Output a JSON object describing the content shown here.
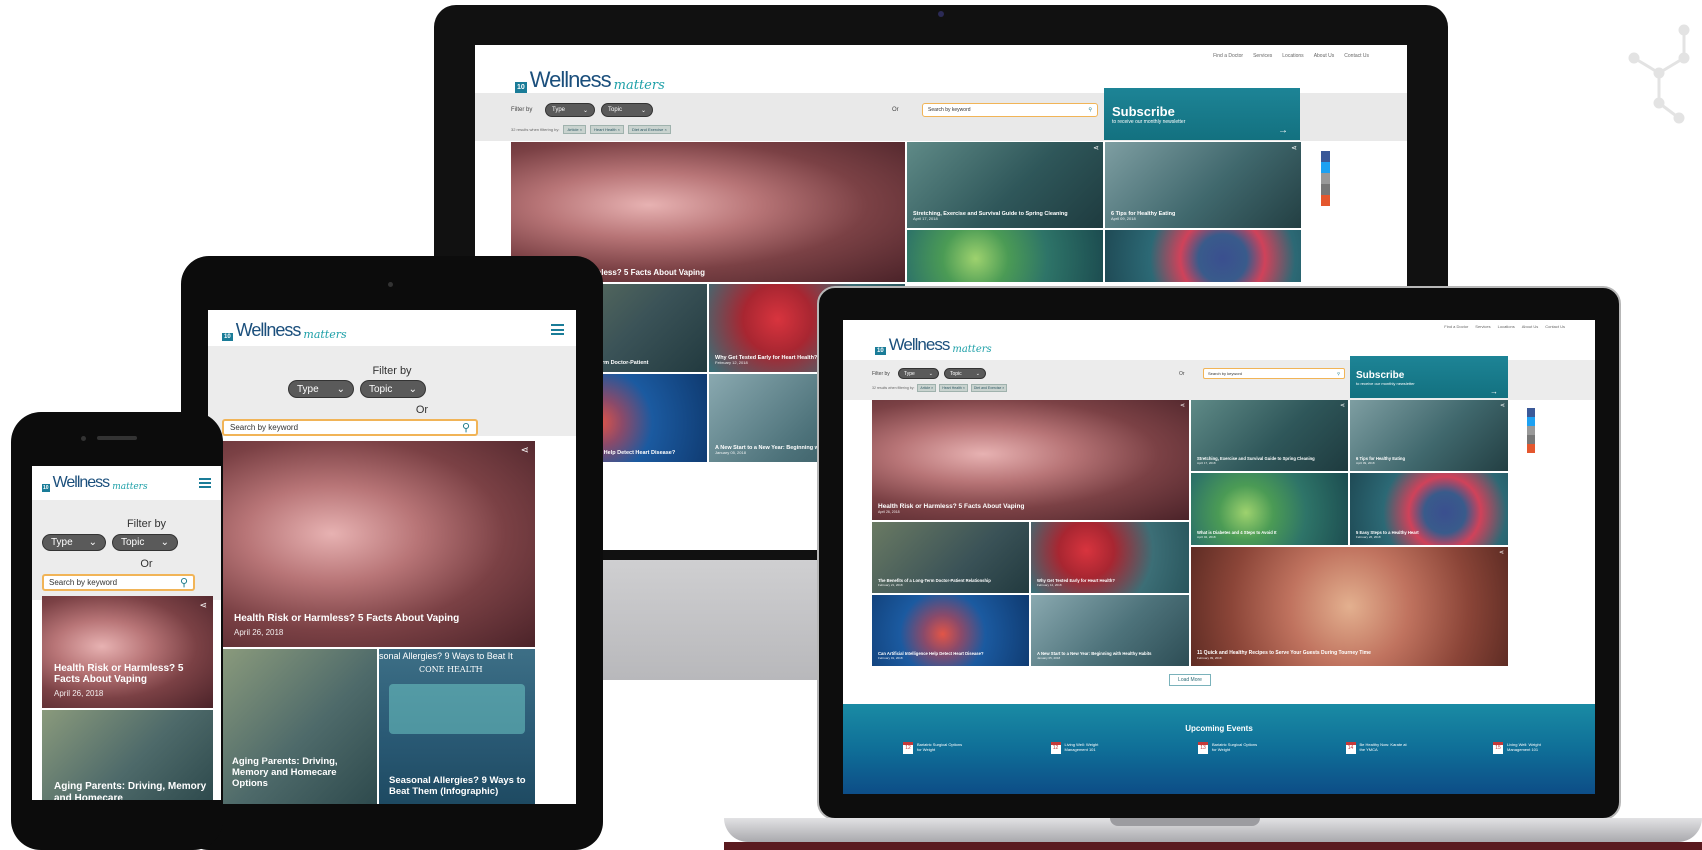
{
  "brand": {
    "logo_word": "Wellness",
    "logo_script": "matters",
    "logo_mark": "10"
  },
  "top_nav": [
    "Find a Doctor",
    "Services",
    "Locations",
    "About Us",
    "Contact Us"
  ],
  "filter": {
    "label": "Filter by",
    "type_label": "Type",
    "topic_label": "Topic",
    "or_label": "Or",
    "search_placeholder": "Search by keyword",
    "results_text": "32 results when filtering by:",
    "chips": [
      "Article",
      "Heart Health",
      "Diet and Exercise"
    ]
  },
  "subscribe": {
    "title": "Subscribe",
    "subtitle": "to receive our monthly newsletter",
    "arrow": "→"
  },
  "share_colors": [
    "#3b5998",
    "#1da1f2",
    "#888888",
    "#666666",
    "#e4572e"
  ],
  "articles": {
    "vaping": {
      "title": "Health Risk or Harmless? 5 Facts About Vaping",
      "date": "April 26, 2018"
    },
    "vaping_crop": {
      "title": "rmless? 5 Facts About Vaping"
    },
    "stretching": {
      "title": "Stretching, Exercise and Survival Guide to Spring Cleaning",
      "date": "April 17, 2018"
    },
    "tips": {
      "title": "6 Tips for Healthy Eating",
      "date": "April 09, 2018"
    },
    "diabetes": {
      "title": "What is Diabetes and 4 Steps to Avoid It",
      "date": "April 02, 2018"
    },
    "easy_steps": {
      "title": "5 Easy Steps to a Healthy Heart",
      "date": "February 26, 2018"
    },
    "doctor": {
      "title": "The Benefits of a Long-Term Doctor-Patient Relationship",
      "date": "February 21, 2018"
    },
    "doctor_crop": {
      "title": "Term Doctor-Patient"
    },
    "why_tested": {
      "title": "Why Get Tested Early for Heart Health?",
      "date": "February 12, 2018"
    },
    "why_tested_crop": {
      "title": "Why Get Tested Early for Heart Health?",
      "date": "February 12, 2018"
    },
    "ai": {
      "title": "Can Artificial Intelligence Help Detect Heart Disease?",
      "date": "February 01, 2018"
    },
    "ai_crop": {
      "title": "ce Help Detect Heart Disease?"
    },
    "new_start": {
      "title": "A New Start to a New Year: Beginning with Healthy Habits",
      "date": "January 05, 2018"
    },
    "new_start_crop": {
      "title": "A New Start to a New Year: Beginning with Healthy Habits",
      "date": "January 05, 2018"
    },
    "recipes": {
      "title": "11 Quick and Healthy Recipes to Serve Your Guests During Tourney Time",
      "date": "February 09, 2018"
    },
    "aging": {
      "title": "Aging Parents: Driving, Memory and Homecare Options"
    },
    "aging_crop": {
      "title": "Aging Parents: Driving, Memory and Homecare"
    },
    "allergies": {
      "title": "Seasonal Allergies? 9 Ways to Beat Them (Infographic)",
      "banner": "sonal Allergies? 9 Ways to Beat It",
      "brand": "CONE HEALTH"
    }
  },
  "load_more": "Load More",
  "events": {
    "title": "Upcoming Events",
    "items": [
      {
        "day": "12",
        "title": "Bariatric Surgical Options for Weight"
      },
      {
        "day": "12",
        "title": "Living Well: Weight Management 101"
      },
      {
        "day": "13",
        "title": "Bariatric Surgical Options for Weight"
      },
      {
        "day": "14",
        "title": "Be Healthy Now: Karate at the YMCA"
      },
      {
        "day": "15",
        "title": "Living Well: Weight Management 101"
      }
    ]
  },
  "icons": {
    "search": "search-icon",
    "menu": "hamburger-menu-icon",
    "share": "share-icon",
    "chevron": "chevron-down-icon",
    "molecule": "molecule-decoration-icon"
  }
}
